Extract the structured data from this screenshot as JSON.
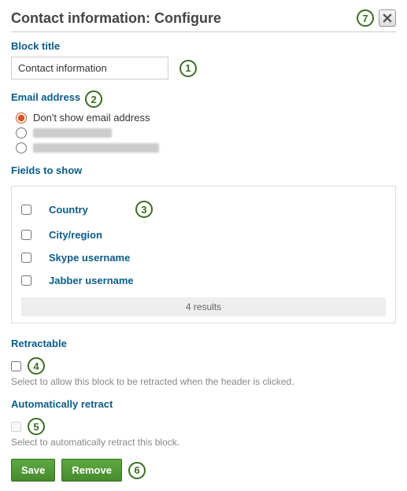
{
  "dialog_title": "Contact information: Configure",
  "block_title": {
    "label": "Block title",
    "value": "Contact information"
  },
  "email": {
    "label": "Email address",
    "options": {
      "dont_show": "Don't show email address"
    }
  },
  "fields": {
    "label": "Fields to show",
    "items": [
      {
        "label": "Country"
      },
      {
        "label": "City/region"
      },
      {
        "label": "Skype username"
      },
      {
        "label": "Jabber username"
      }
    ],
    "results": "4 results"
  },
  "retractable": {
    "label": "Retractable",
    "help": "Select to allow this block to be retracted when the header is clicked."
  },
  "auto_retract": {
    "label": "Automatically retract",
    "help": "Select to automatically retract this block."
  },
  "buttons": {
    "save": "Save",
    "remove": "Remove"
  },
  "annotations": {
    "a1": "1",
    "a2": "2",
    "a3": "3",
    "a4": "4",
    "a5": "5",
    "a6": "6",
    "a7": "7"
  }
}
